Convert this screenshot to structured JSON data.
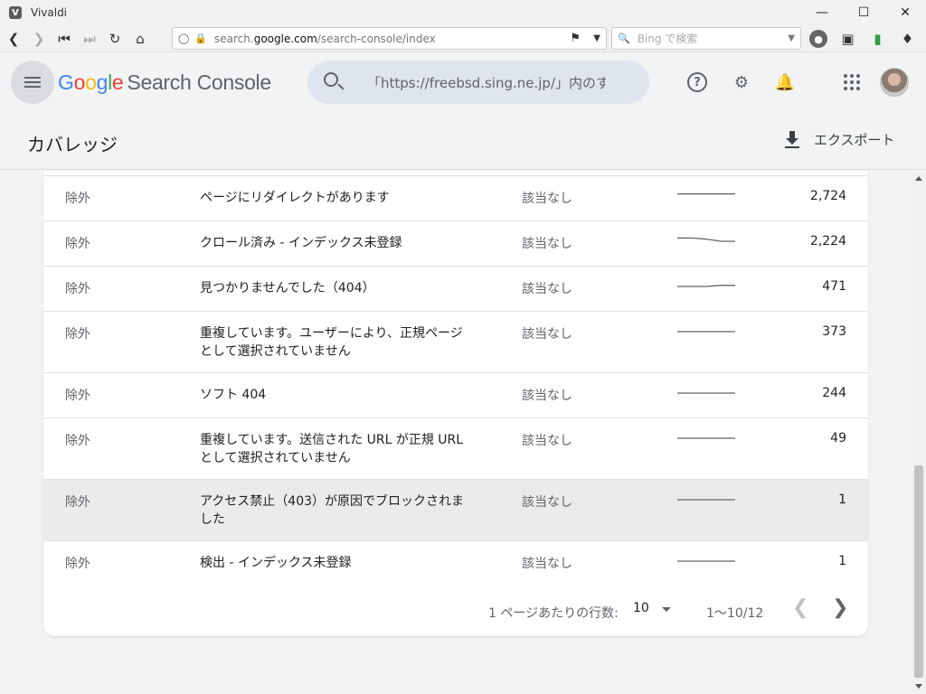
{
  "browser": {
    "title": "Vivaldi",
    "url_prefix": "search.",
    "url_domain": "google.com",
    "url_path": "/search-console/index",
    "search_placeholder": "Bing で検索"
  },
  "header": {
    "logo_google": [
      "G",
      "o",
      "o",
      "g",
      "l",
      "e"
    ],
    "product": "Search Console",
    "search_text": "「https://freebsd.sing.ne.jp/」内のすべてのURLを検査"
  },
  "page": {
    "title": "カバレッジ",
    "export_label": "エクスポート"
  },
  "table": {
    "rows": [
      {
        "type": "除外",
        "reason": "ページにリダイレクトがあります",
        "validation": "該当なし",
        "count": "2,724",
        "trend": [
          3,
          3,
          3,
          3,
          3
        ]
      },
      {
        "type": "除外",
        "reason": "クロール済み - インデックス未登録",
        "validation": "該当なし",
        "count": "2,224",
        "trend": [
          2,
          2,
          3,
          5,
          5
        ]
      },
      {
        "type": "除外",
        "reason": "見つかりませんでした（404）",
        "validation": "該当なし",
        "count": "471",
        "trend": [
          5,
          5,
          5,
          4,
          4
        ]
      },
      {
        "type": "除外",
        "reason": "重複しています。ユーザーにより、正規ページとして選択されていません",
        "validation": "該当なし",
        "count": "373",
        "trend": [
          5,
          5,
          5,
          5,
          5
        ]
      },
      {
        "type": "除外",
        "reason": "ソフト 404",
        "validation": "該当なし",
        "count": "244",
        "trend": [
          5,
          5,
          5,
          5,
          5
        ]
      },
      {
        "type": "除外",
        "reason": "重複しています。送信された URL が正規 URL として選択されていません",
        "validation": "該当なし",
        "count": "49",
        "trend": [
          5,
          5,
          5,
          5,
          5
        ]
      },
      {
        "type": "除外",
        "reason": "アクセス禁止（403）が原因でブロックされました",
        "validation": "該当なし",
        "count": "1",
        "trend": [
          5,
          5,
          5,
          5,
          5
        ]
      },
      {
        "type": "除外",
        "reason": "検出 - インデックス未登録",
        "validation": "該当なし",
        "count": "1",
        "trend": [
          5,
          5,
          5,
          5,
          5
        ]
      }
    ]
  },
  "pager": {
    "rows_label": "1 ページあたりの行数:",
    "rows_value": "10",
    "range": "1〜10/12"
  }
}
